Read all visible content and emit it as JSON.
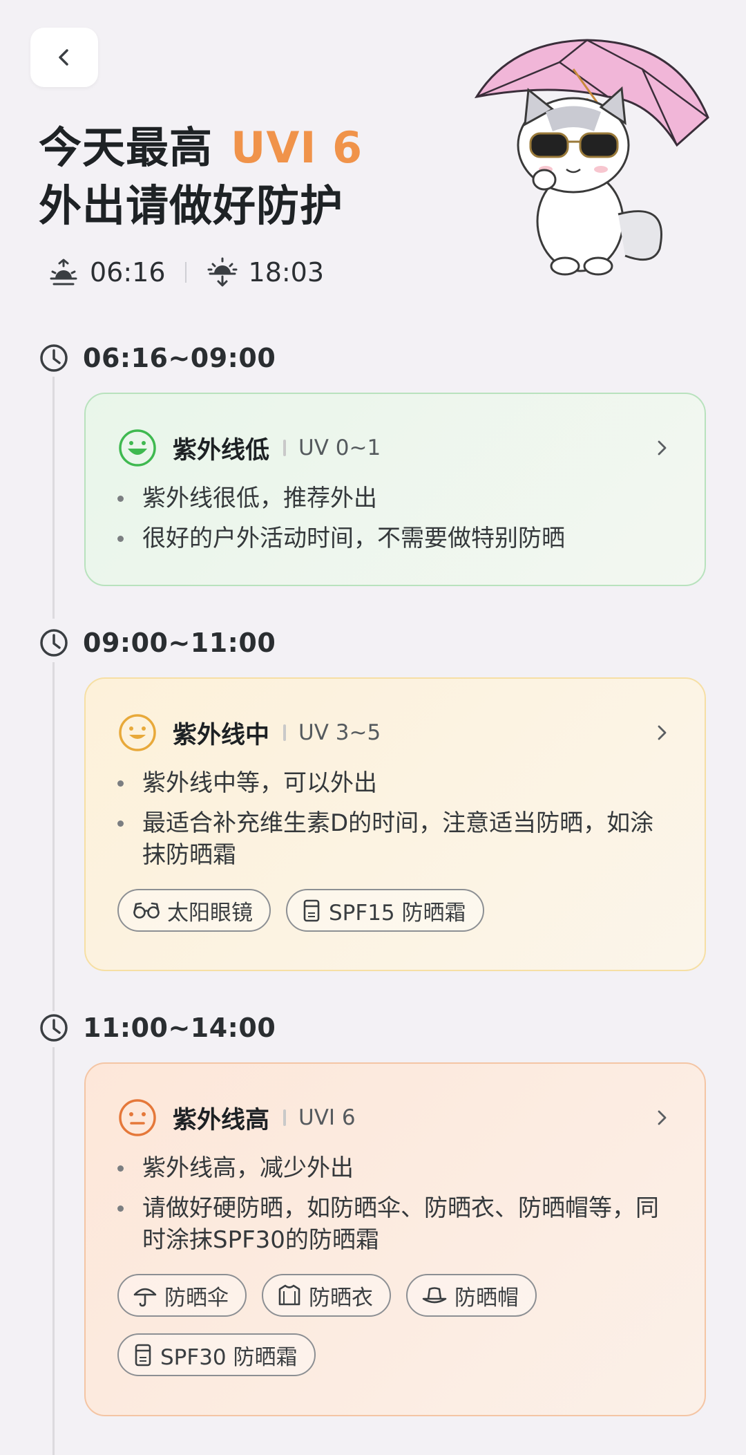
{
  "header": {
    "title_prefix": "今天最高",
    "title_uvi": "UVI 6",
    "subtitle": "外出请做好防护",
    "sunrise": "06:16",
    "sunset": "18:03"
  },
  "sections": [
    {
      "time_range": "06:16~09:00",
      "level": "紫外线低",
      "uv_range": "UV 0~1",
      "bullets": [
        "紫外线很低，推荐外出",
        "很好的户外活动时间，不需要做特别防晒"
      ],
      "chips": []
    },
    {
      "time_range": "09:00~11:00",
      "level": "紫外线中",
      "uv_range": "UV 3~5",
      "bullets": [
        "紫外线中等，可以外出",
        "最适合补充维生素D的时间，注意适当防晒，如涂抹防晒霜"
      ],
      "chips": [
        {
          "label": "太阳眼镜",
          "icon": "sunglasses-icon"
        },
        {
          "label": "SPF15 防晒霜",
          "icon": "sunscreen-icon"
        }
      ]
    },
    {
      "time_range": "11:00~14:00",
      "level": "紫外线高",
      "uv_range": "UVI 6",
      "bullets": [
        "紫外线高，减少外出",
        "请做好硬防晒，如防晒伞、防晒衣、防晒帽等，同时涂抹SPF30的防晒霜"
      ],
      "chips": [
        {
          "label": "防晒伞",
          "icon": "umbrella-icon"
        },
        {
          "label": "防晒衣",
          "icon": "shirt-icon"
        },
        {
          "label": "防晒帽",
          "icon": "hat-icon"
        },
        {
          "label": "SPF30 防晒霜",
          "icon": "sunscreen-icon"
        }
      ]
    }
  ],
  "colors": {
    "accent_orange": "#f0934a",
    "low_green": "#3fb950",
    "mid_yellow": "#e8a93a",
    "high_orange": "#e5783a"
  }
}
